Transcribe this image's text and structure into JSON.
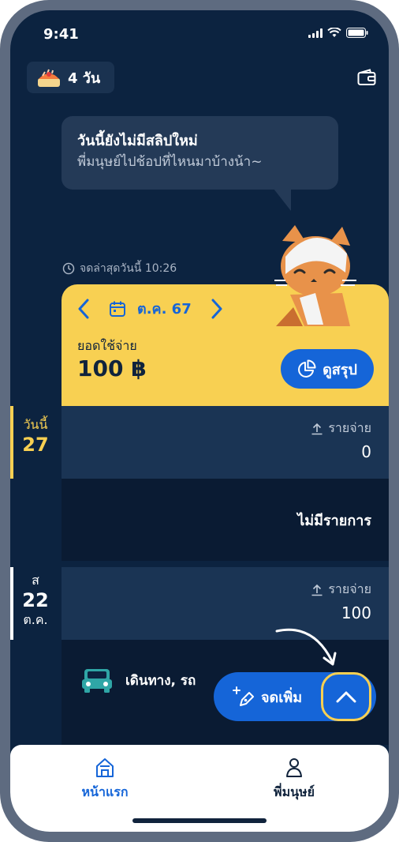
{
  "status_bar": {
    "time": "9:41"
  },
  "streak": {
    "text": "4 วัน"
  },
  "bubble": {
    "title": "วันนี้ยังไม่มีสลิปใหม่",
    "subtitle": "พี่มนุษย์ไปช้อปที่ไหนมาบ้างน้า~"
  },
  "last_updated": "จดล่าสุดวันนี้ 10:26",
  "summary": {
    "month": "ต.ค. 67",
    "spend_label": "ยอดใช้จ่าย",
    "spend_total": "100 ฿",
    "summary_button": "ดูสรุป"
  },
  "days": [
    {
      "day_label": "วันนี้",
      "day_num": "27",
      "month_label": "",
      "expense_label": "รายจ่าย",
      "expense_amount": "0",
      "empty_text": "ไม่มีรายการ",
      "accent": "#f8d052"
    },
    {
      "day_label": "ส",
      "day_num": "22",
      "month_label": "ต.ค.",
      "expense_label": "รายจ่าย",
      "expense_amount": "100",
      "transactions": [
        {
          "label": "เดินทาง, รถ",
          "icon": "car-icon"
        }
      ],
      "accent": "#ffffff"
    }
  ],
  "fab": {
    "add_label": "จดเพิ่ม"
  },
  "tabbar": {
    "home": "หน้าแรก",
    "profile": "พี่มนุษย์"
  },
  "colors": {
    "primary": "#1565d8",
    "card": "#f8d052",
    "background": "#0c2340"
  }
}
